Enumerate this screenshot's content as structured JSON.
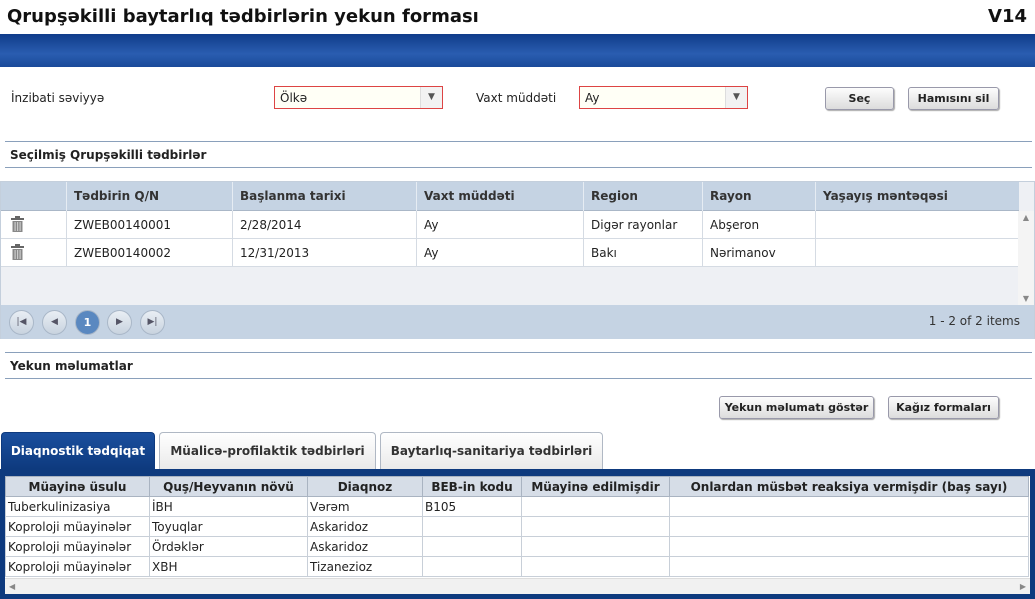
{
  "window": {
    "title": "Qrupşəkilli baytarlıq tədbirlərin yekun forması",
    "version": "V14"
  },
  "filters": {
    "admin_level_label": "İnzibati səviyyə",
    "admin_level_value": "Ölkə",
    "period_label": "Vaxt müddəti",
    "period_value": "Ay",
    "select_button": "Seç",
    "clear_all_button": "Hamısını sil"
  },
  "selected_section": {
    "title": "Seçilmiş Qrupşəkilli tədbirlər"
  },
  "selected_grid": {
    "columns": [
      "Tədbirin Q/N",
      "Başlanma tarixi",
      "Vaxt müddəti",
      "Region",
      "Rayon",
      "Yaşayış məntəqəsi"
    ],
    "rows": [
      [
        "ZWEB00140001",
        "2/28/2014",
        "Ay",
        "Digər rayonlar",
        "Abşeron",
        ""
      ],
      [
        "ZWEB00140002",
        "12/31/2013",
        "Ay",
        "Bakı",
        "Nərimanov",
        ""
      ]
    ],
    "pager": {
      "current_page": "1",
      "info": "1 - 2 of 2 items"
    }
  },
  "summary_section": {
    "title": "Yekun məlumatlar",
    "show_summary_button": "Yekun məlumatı göstər",
    "paper_forms_button": "Kağız formaları"
  },
  "tabs": [
    {
      "label": "Diaqnostik tədqiqat",
      "active": true
    },
    {
      "label": "Müalicə-profilaktik tədbirləri",
      "active": false
    },
    {
      "label": "Baytarlıq-sanitariya tədbirləri",
      "active": false
    }
  ],
  "diag_grid": {
    "columns": [
      "Müayinə üsulu",
      "Quş/Heyvanın növü",
      "Diaqnoz",
      "BEB-in kodu",
      "Müayinə edilmişdir",
      "Onlardan müsbət reaksiya vermişdir (baş sayı)"
    ],
    "rows": [
      [
        "Tuberkulinizasiya",
        "İBH",
        "Vərəm",
        "B105",
        "",
        ""
      ],
      [
        "Koproloji müayinələr",
        "Toyuqlar",
        "Askaridoz",
        "",
        "",
        ""
      ],
      [
        "Koproloji müayinələr",
        "Ördəklər",
        "Askaridoz",
        "",
        "",
        ""
      ],
      [
        "Koproloji müayinələr",
        "XBH",
        "Tizanezioz",
        "",
        "",
        ""
      ]
    ]
  },
  "icons": {
    "delete": "trash-icon",
    "dropdown": "triangle-down-icon"
  },
  "colors": {
    "header_band": "#1a4a9a",
    "active_tab": "#0e3a7e",
    "grid_header": "#c5d3e3"
  }
}
